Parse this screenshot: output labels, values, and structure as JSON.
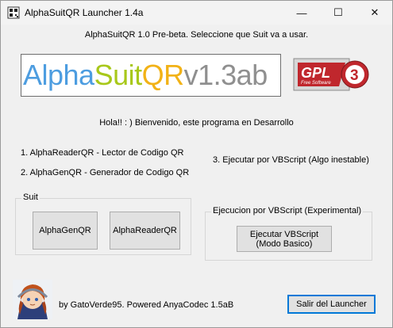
{
  "window": {
    "title": "AlphaSuitQR Launcher 1.4a",
    "controls": {
      "minimize": "—",
      "maximize": "☐",
      "close": "✕"
    }
  },
  "header": {
    "intro_text": "AlphaSuitQR 1.0 Pre-beta. Seleccione que Suit va a usar.",
    "logo": {
      "part1": "Alpha",
      "part2": "Suit",
      "part3": "QR",
      "part4": "v1.3ab"
    },
    "gpl_logo": {
      "text": "GPL",
      "subtext": "Free Software",
      "number": "3"
    }
  },
  "welcome_text": "Hola!! : ) Bienvenido, este programa en Desarrollo",
  "options": {
    "item1": "1. AlphaReaderQR - Lector de Codigo QR",
    "item2": "2. AlphaGenQR - Generador de Codigo QR",
    "item3": "3. Ejecutar por VBScript (Algo inestable)"
  },
  "suit_group": {
    "label": "Suit",
    "gen_button": "AlphaGenQR",
    "reader_button": "AlphaReaderQR"
  },
  "vbs_group": {
    "label": "Ejecucion por VBScript (Experimental)",
    "run_button_line1": "Ejecutar VBScript",
    "run_button_line2": "(Modo Basico)"
  },
  "footer": {
    "credits": "by GatoVerde95. Powered AnyaCodec 1.5aB",
    "exit_button": "Salir del Launcher"
  },
  "colors": {
    "window_bg": "#f0f0f0",
    "button_bg": "#e1e1e1",
    "button_border": "#adadad",
    "default_button_border": "#0078d7",
    "logo_alpha": "#4d9de0",
    "logo_suit": "#a8c81a",
    "logo_qr": "#f2b216",
    "logo_version": "#8f8f8f",
    "gpl_red": "#c0272d"
  }
}
